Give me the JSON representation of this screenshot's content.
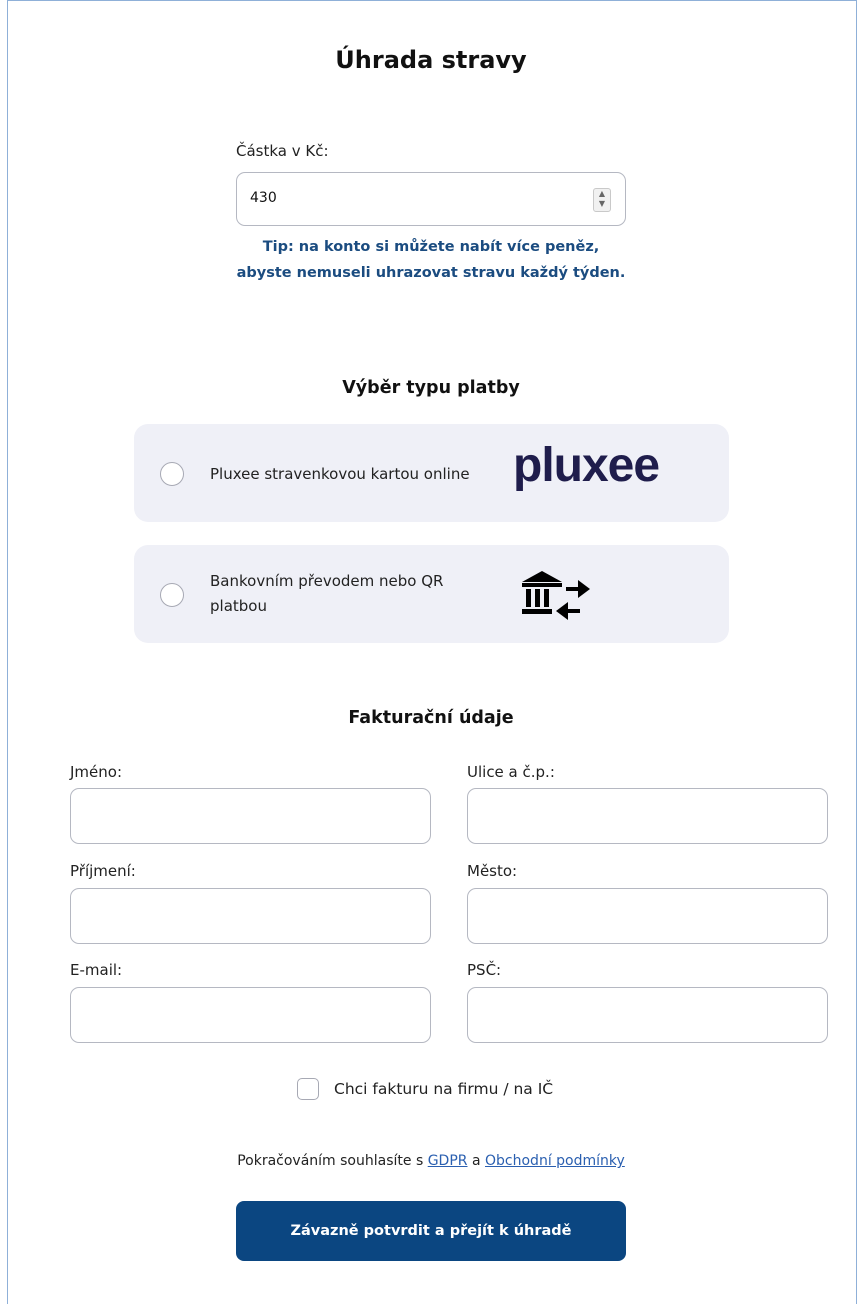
{
  "title": "Úhrada stravy",
  "amount": {
    "label": "Částka v Kč:",
    "value": "430"
  },
  "tip": "Tip: na konto si můžete nabít více peněz, abyste nemuseli uhrazovat stravu každý týden.",
  "payment": {
    "heading": "Výběr typu platby",
    "options": [
      {
        "label": "Pluxee stravenkovou kartou online",
        "logo_text": "pluxee",
        "icon": "pluxee-logo"
      },
      {
        "label": "Bankovním převodem nebo QR platbou",
        "icon": "bank-transfer-icon"
      }
    ]
  },
  "billing": {
    "heading": "Fakturační údaje",
    "fields": {
      "first_name": "Jméno:",
      "last_name": "Příjmení:",
      "email": "E-mail:",
      "street": "Ulice a č.p.:",
      "city": "Město:",
      "zip": "PSČ:"
    }
  },
  "company_checkbox": {
    "label": "Chci fakturu na firmu / na IČ",
    "checked": false
  },
  "consent": {
    "prefix": "Pokračováním souhlasíte s",
    "gdpr": "GDPR",
    "middle": "a",
    "terms": "Obchodní podmínky"
  },
  "submit_label": "Závazně potvrdit a přejít k úhradě",
  "colors": {
    "primary": "#0b4681",
    "tip_text": "#1b4c80",
    "card_bg": "#eff0f7",
    "link": "#2a5fb0",
    "pluxee_logo": "#1f1d4c"
  }
}
